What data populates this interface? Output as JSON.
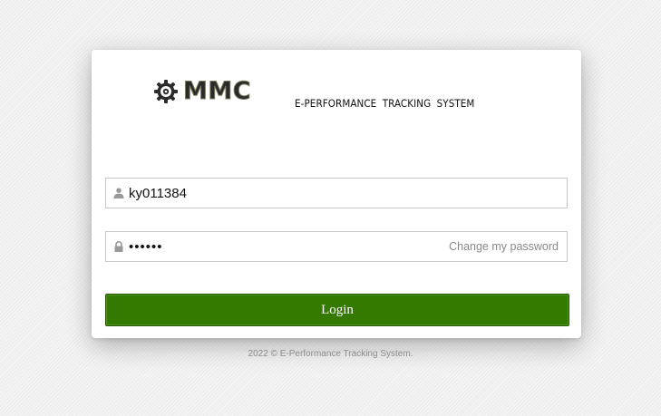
{
  "brand": {
    "logo_text": "MMC",
    "logo_icon": "gear-icon",
    "system_title": "E-PERFORMANCE TRACKING SYSTEM"
  },
  "login_form": {
    "username": {
      "value": "ky011384",
      "icon": "user-icon"
    },
    "password": {
      "value": "••••••",
      "icon": "lock-icon",
      "change_link": "Change my password"
    },
    "submit_label": "Login"
  },
  "footer": {
    "text": "2022 © E-Performance Tracking System."
  },
  "colors": {
    "login_button": "#347a00",
    "card": "#ffffff",
    "footer_text": "#8c8c8c"
  }
}
